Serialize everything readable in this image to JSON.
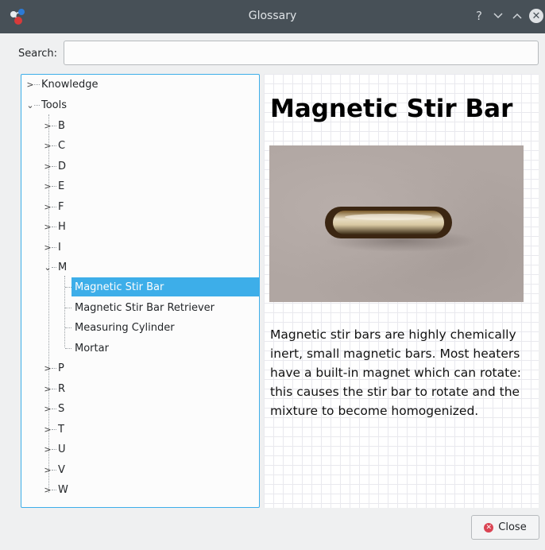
{
  "window": {
    "title": "Glossary",
    "help_glyph": "?",
    "min_glyph": "⌄",
    "max_glyph": "⌃",
    "close_glyph": "✕",
    "app_icon": "molecule-icon"
  },
  "search": {
    "label": "Search:",
    "value": "",
    "placeholder": ""
  },
  "tree": {
    "knowledge": "Knowledge",
    "tools": "Tools",
    "letters_before": [
      "B",
      "C",
      "D",
      "E",
      "F",
      "H",
      "I"
    ],
    "m": "M",
    "m_items": [
      "Magnetic Stir Bar",
      "Magnetic Stir Bar Retriever",
      "Measuring Cylinder",
      "Mortar"
    ],
    "letters_after": [
      "P",
      "R",
      "S",
      "T",
      "U",
      "V",
      "W"
    ],
    "selected": "Magnetic Stir Bar"
  },
  "detail": {
    "title": "Magnetic Stir Bar",
    "description": "Magnetic stir bars are highly chemically inert, small magnetic bars. Most heaters have a built-in magnet which can rotate: this causes the stir bar to rotate and the mixture to become homogenized."
  },
  "buttons": {
    "close": "Close"
  },
  "colors": {
    "accent": "#3daee9",
    "titlebar": "#475057",
    "close_icon": "#da4453"
  }
}
